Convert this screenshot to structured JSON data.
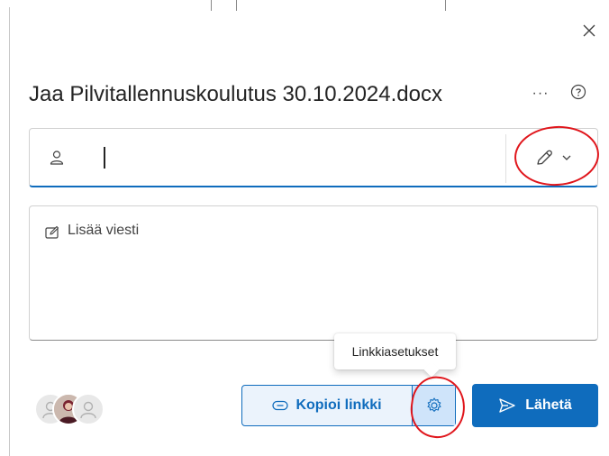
{
  "dialog": {
    "title": "Jaa Pilvitallennuskoulutus 30.10.2024.docx",
    "more_label": "···",
    "close_icon": "close-icon",
    "help_icon": "question-circle-icon"
  },
  "people_picker": {
    "value": "",
    "person_icon": "person-icon",
    "permission_icon": "pencil-icon",
    "dropdown_icon": "chevron-down-icon"
  },
  "message": {
    "placeholder": "Lisää viesti",
    "icon": "edit-note-icon"
  },
  "tooltip": {
    "text": "Linkkiasetukset"
  },
  "footer": {
    "copy_link_label": "Kopioi linkki",
    "copy_link_icon": "link-icon",
    "settings_icon": "gear-icon",
    "send_label": "Lähetä",
    "send_icon": "send-icon"
  },
  "colors": {
    "accent": "#0f6cbd",
    "accent_light": "#ebf3fc",
    "annotation_red": "#e0161c"
  }
}
